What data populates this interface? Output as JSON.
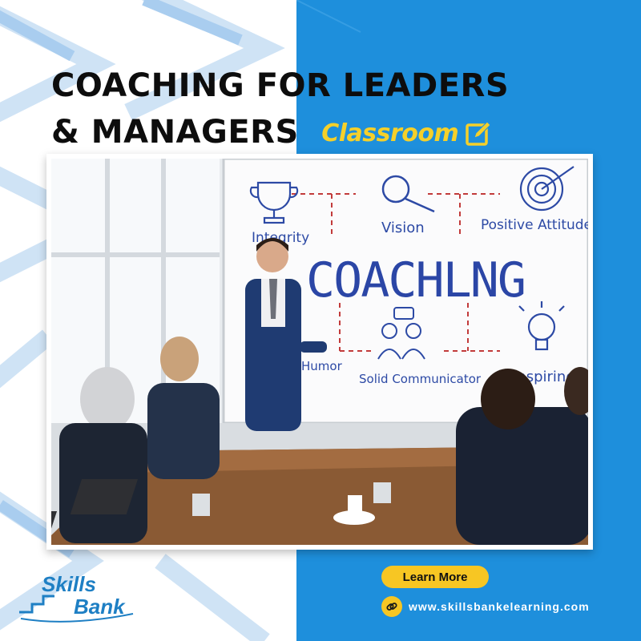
{
  "headline": {
    "line1": "COACHING FOR LEADERS",
    "line2": "& MANAGERS",
    "tag": "Classroom"
  },
  "whiteboard": {
    "main_word": "COACHLNG",
    "labels": [
      "Integrity",
      "Vision",
      "Positive Attitude",
      "Humor",
      "Solid Communicator",
      "Inspiring"
    ]
  },
  "cta": {
    "button_label": "Learn More",
    "website": "www.skillsbankelearning.com"
  },
  "logo": {
    "word1": "Skills",
    "word2": "Bank"
  },
  "colors": {
    "accent_blue": "#1e8fdc",
    "accent_yellow": "#f7c623",
    "tag_yellow": "#f5d02a"
  }
}
